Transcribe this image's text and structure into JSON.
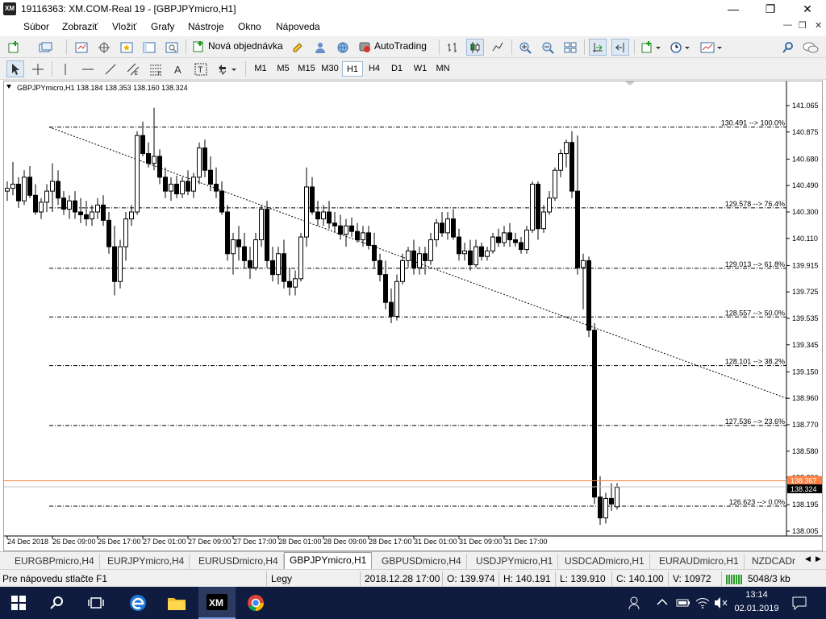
{
  "window": {
    "logo": "XM",
    "title": "19116363: XM.COM-Real 19 - [GBPJPYmicro,H1]",
    "minimize": "—",
    "maximize": "❐",
    "close": "✕"
  },
  "menu": {
    "items": [
      "Súbor",
      "Zobraziť",
      "Vložiť",
      "Grafy",
      "Nástroje",
      "Okno",
      "Nápoveda"
    ],
    "mdi": [
      "—",
      "❐",
      "✕"
    ]
  },
  "toolbar": {
    "new_order": "Nová objednávka",
    "autotrading": "AutoTrading"
  },
  "timeframes": {
    "items": [
      "M1",
      "M5",
      "M15",
      "M30",
      "H1",
      "H4",
      "D1",
      "W1",
      "MN"
    ],
    "active": "H1"
  },
  "chart": {
    "header": "GBPJPYmicro,H1  138.184 138.353 138.160 138.324",
    "current_price": "138.324",
    "ask_price": "138.367",
    "price_ticks": [
      "141.065",
      "140.875",
      "140.680",
      "140.490",
      "140.300",
      "140.110",
      "139.915",
      "139.725",
      "139.535",
      "139.345",
      "139.150",
      "138.960",
      "138.770",
      "138.580",
      "138.390",
      "138.195",
      "138.005"
    ],
    "time_labels": [
      "24 Dec 2018",
      "26 Dec 09:00",
      "26 Dec 17:00",
      "27 Dec 01:00",
      "27 Dec 09:00",
      "27 Dec 17:00",
      "28 Dec 01:00",
      "28 Dec 09:00",
      "28 Dec 17:00",
      "31 Dec 01:00",
      "31 Dec 09:00",
      "31 Dec 17:00"
    ],
    "fibo_levels": [
      {
        "label": "130.491 --> 100.0%",
        "price": 140.91
      },
      {
        "label": "129.578 --> 76.4%",
        "price": 140.33
      },
      {
        "label": "129.013 --> 61.8%",
        "price": 139.895
      },
      {
        "label": "128.557 --> 50.0%",
        "price": 139.545
      },
      {
        "label": "128.101 --> 38.2%",
        "price": 139.195
      },
      {
        "label": "127.536 --> 23.6%",
        "price": 138.765
      },
      {
        "label": "126.623 --> 0.0%",
        "price": 138.185
      }
    ]
  },
  "chart_data": {
    "type": "candlestick",
    "symbol": "GBPJPYmicro",
    "timeframe": "H1",
    "ylim": [
      138.005,
      141.065
    ],
    "trendline": {
      "from": [
        0,
        140.91
      ],
      "to": [
        1,
        138.96
      ]
    },
    "candles": [
      [
        140.45,
        140.52,
        140.38,
        140.47
      ],
      [
        140.47,
        140.66,
        140.42,
        140.5
      ],
      [
        140.5,
        140.55,
        140.33,
        140.38
      ],
      [
        140.38,
        140.6,
        140.35,
        140.55
      ],
      [
        140.55,
        140.63,
        140.4,
        140.42
      ],
      [
        140.42,
        140.5,
        140.28,
        140.3
      ],
      [
        140.3,
        140.4,
        140.25,
        140.37
      ],
      [
        140.37,
        140.5,
        140.3,
        140.45
      ],
      [
        140.45,
        140.65,
        140.3,
        140.52
      ],
      [
        140.52,
        140.6,
        140.35,
        140.4
      ],
      [
        140.4,
        140.45,
        140.28,
        140.32
      ],
      [
        140.32,
        140.42,
        140.25,
        140.38
      ],
      [
        140.38,
        140.45,
        140.25,
        140.3
      ],
      [
        140.3,
        140.4,
        140.22,
        140.28
      ],
      [
        140.28,
        140.38,
        140.2,
        140.25
      ],
      [
        140.25,
        140.35,
        140.2,
        140.3
      ],
      [
        140.3,
        140.4,
        140.25,
        140.35
      ],
      [
        140.35,
        140.42,
        140.2,
        140.24
      ],
      [
        140.24,
        140.3,
        140.0,
        140.05
      ],
      [
        140.05,
        140.2,
        139.7,
        139.8
      ],
      [
        139.8,
        140.1,
        139.75,
        140.05
      ],
      [
        140.05,
        140.3,
        139.95,
        140.25
      ],
      [
        140.25,
        140.35,
        140.2,
        140.3
      ],
      [
        140.3,
        140.88,
        140.28,
        140.85
      ],
      [
        140.85,
        140.95,
        140.7,
        140.72
      ],
      [
        140.72,
        140.8,
        140.62,
        140.65
      ],
      [
        140.65,
        141.05,
        140.6,
        140.7
      ],
      [
        140.7,
        140.75,
        140.5,
        140.55
      ],
      [
        140.55,
        140.62,
        140.4,
        140.45
      ],
      [
        140.45,
        140.55,
        140.38,
        140.5
      ],
      [
        140.5,
        140.56,
        140.4,
        140.43
      ],
      [
        140.43,
        140.55,
        140.4,
        140.52
      ],
      [
        140.52,
        140.6,
        140.42,
        140.45
      ],
      [
        140.45,
        140.58,
        140.4,
        140.55
      ],
      [
        140.55,
        140.8,
        140.5,
        140.76
      ],
      [
        140.76,
        140.82,
        140.55,
        140.6
      ],
      [
        140.6,
        140.7,
        140.45,
        140.5
      ],
      [
        140.5,
        140.62,
        140.4,
        140.45
      ],
      [
        140.45,
        140.52,
        140.28,
        140.3
      ],
      [
        140.3,
        140.35,
        139.95,
        140.0
      ],
      [
        140.0,
        140.15,
        139.85,
        140.1
      ],
      [
        140.1,
        140.2,
        139.95,
        140.05
      ],
      [
        140.05,
        140.15,
        139.9,
        139.95
      ],
      [
        139.95,
        140.05,
        139.82,
        139.9
      ],
      [
        139.9,
        140.15,
        139.88,
        140.1
      ],
      [
        140.1,
        140.35,
        140.05,
        140.32
      ],
      [
        140.32,
        140.38,
        139.9,
        139.95
      ],
      [
        139.95,
        140.05,
        139.8,
        139.85
      ],
      [
        139.85,
        140.05,
        139.78,
        140.0
      ],
      [
        140.0,
        140.1,
        139.75,
        139.8
      ],
      [
        139.8,
        139.9,
        139.7,
        139.76
      ],
      [
        139.76,
        139.88,
        139.7,
        139.82
      ],
      [
        139.82,
        140.15,
        139.8,
        140.12
      ],
      [
        140.12,
        140.62,
        140.05,
        140.48
      ],
      [
        140.48,
        140.55,
        140.28,
        140.3
      ],
      [
        140.3,
        140.38,
        140.2,
        140.25
      ],
      [
        140.25,
        140.35,
        140.2,
        140.3
      ],
      [
        140.3,
        140.38,
        140.18,
        140.22
      ],
      [
        140.22,
        140.3,
        140.15,
        140.2
      ],
      [
        140.2,
        140.28,
        140.1,
        140.14
      ],
      [
        140.14,
        140.25,
        140.05,
        140.2
      ],
      [
        140.2,
        140.26,
        140.12,
        140.16
      ],
      [
        140.16,
        140.22,
        140.08,
        140.1
      ],
      [
        140.1,
        140.2,
        140.05,
        140.15
      ],
      [
        140.15,
        140.2,
        140.03,
        140.06
      ],
      [
        140.06,
        140.15,
        139.9,
        139.95
      ],
      [
        139.95,
        140.0,
        139.8,
        139.85
      ],
      [
        139.85,
        139.95,
        139.6,
        139.65
      ],
      [
        139.65,
        139.75,
        139.5,
        139.55
      ],
      [
        139.55,
        139.85,
        139.52,
        139.8
      ],
      [
        139.8,
        140.0,
        139.78,
        139.95
      ],
      [
        139.95,
        140.05,
        139.9,
        140.02
      ],
      [
        140.02,
        140.1,
        139.85,
        139.9
      ],
      [
        139.9,
        140.05,
        139.85,
        140.0
      ],
      [
        140.0,
        140.05,
        139.85,
        139.95
      ],
      [
        139.95,
        140.15,
        139.92,
        140.1
      ],
      [
        140.1,
        140.25,
        140.05,
        140.22
      ],
      [
        140.22,
        140.3,
        140.12,
        140.15
      ],
      [
        140.15,
        140.3,
        140.1,
        140.25
      ],
      [
        140.25,
        140.32,
        140.1,
        140.12
      ],
      [
        140.12,
        140.18,
        139.95,
        140.0
      ],
      [
        140.0,
        140.08,
        139.95,
        140.02
      ],
      [
        140.02,
        140.1,
        139.88,
        139.92
      ],
      [
        139.92,
        140.1,
        139.9,
        140.05
      ],
      [
        140.05,
        140.08,
        139.95,
        139.98
      ],
      [
        139.98,
        140.05,
        139.95,
        140.02
      ],
      [
        140.02,
        140.15,
        140.0,
        140.12
      ],
      [
        140.12,
        140.18,
        140.05,
        140.08
      ],
      [
        140.08,
        140.2,
        140.05,
        140.15
      ],
      [
        140.15,
        140.22,
        140.05,
        140.1
      ],
      [
        140.1,
        140.15,
        140.05,
        140.08
      ],
      [
        140.08,
        140.12,
        140.0,
        140.03
      ],
      [
        140.03,
        140.2,
        140.0,
        140.17
      ],
      [
        140.17,
        140.52,
        140.15,
        140.5
      ],
      [
        140.5,
        140.52,
        140.1,
        140.18
      ],
      [
        140.18,
        140.35,
        140.15,
        140.3
      ],
      [
        140.3,
        140.45,
        140.28,
        140.4
      ],
      [
        140.4,
        140.62,
        140.38,
        140.6
      ],
      [
        140.6,
        140.75,
        140.55,
        140.72
      ],
      [
        140.72,
        140.82,
        140.62,
        140.8
      ],
      [
        140.8,
        140.88,
        140.4,
        140.45
      ],
      [
        140.45,
        140.85,
        139.85,
        139.9
      ],
      [
        139.9,
        140.0,
        139.6,
        139.95
      ],
      [
        139.95,
        139.98,
        139.4,
        139.45
      ],
      [
        139.45,
        139.5,
        138.2,
        138.25
      ],
      [
        138.25,
        138.4,
        138.05,
        138.1
      ],
      [
        138.1,
        138.28,
        138.06,
        138.24
      ],
      [
        138.24,
        138.35,
        138.15,
        138.2
      ],
      [
        138.18,
        138.35,
        138.16,
        138.32
      ]
    ]
  },
  "tabs": {
    "items": [
      "EURGBPmicro,H4",
      "EURJPYmicro,H4",
      "EURUSDmicro,H4",
      "GBPJPYmicro,H1",
      "GBPUSDmicro,H4",
      "USDJPYmicro,H1",
      "USDCADmicro,H1",
      "EURAUDmicro,H1",
      "NZDCADr"
    ],
    "active": "GBPJPYmicro,H1"
  },
  "status": {
    "help": "Pre nápovedu stlačte F1",
    "profile": "Legy",
    "datetime": "2018.12.28 17:00",
    "open": "O: 139.974",
    "high": "H: 140.191",
    "low": "L: 139.910",
    "close": "C: 140.100",
    "volume": "V: 10972",
    "traffic": "5048/3 kb"
  },
  "taskbar": {
    "time": "13:14",
    "date": "02.01.2019",
    "xm_label": "XM"
  },
  "colors": {
    "ask_line": "#ff8040",
    "price_box": "#000000",
    "fibo": "#000000",
    "taskbar": "#0f1c3f"
  }
}
